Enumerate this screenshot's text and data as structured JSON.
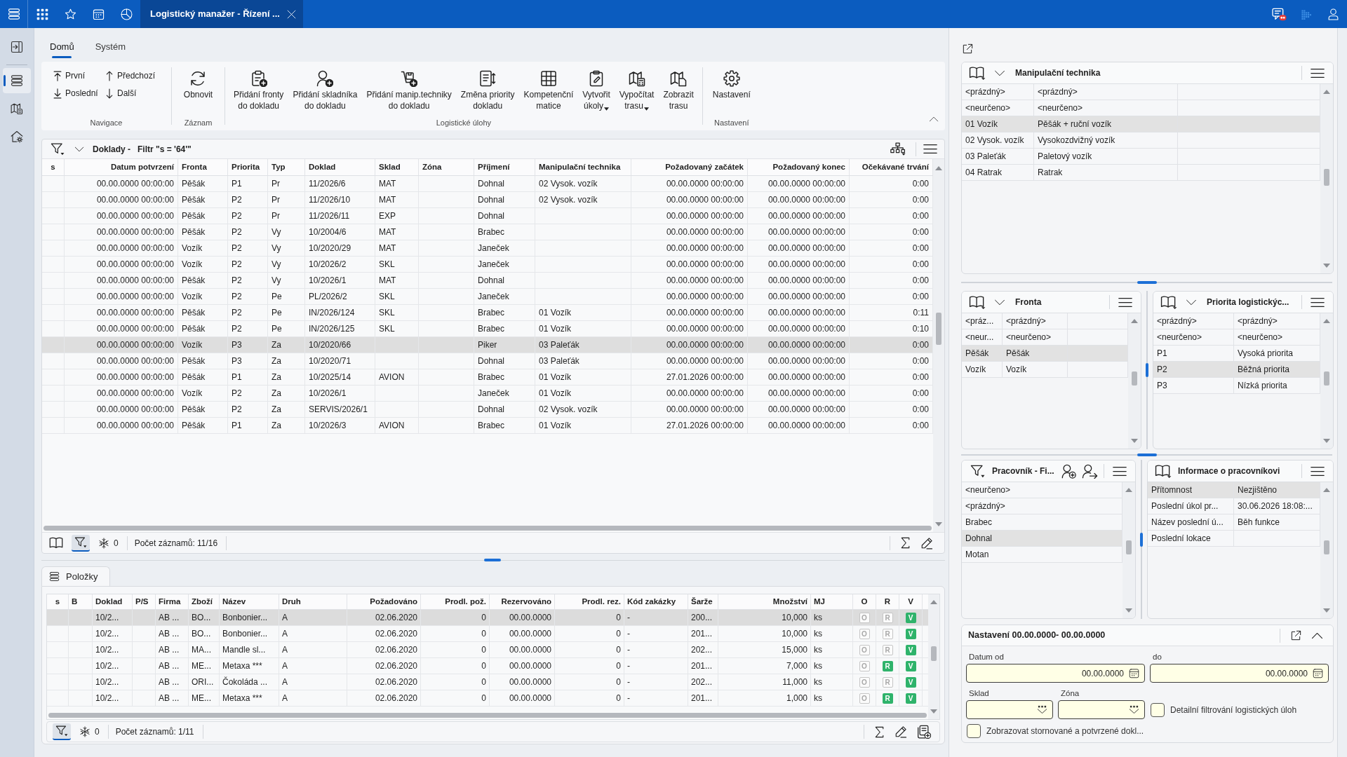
{
  "top_bar": {
    "tabs": [
      {
        "title": "Logistický manažer - Řízení ...",
        "selected": true
      }
    ]
  },
  "sidebar": {
    "items": [
      {
        "selected": false
      },
      {
        "selected": true
      },
      {
        "selected": false
      },
      {
        "selected": false
      }
    ]
  },
  "ribbon": {
    "tabs": [
      {
        "label": "Domů",
        "selected": true
      },
      {
        "label": "Systém",
        "selected": false
      }
    ],
    "groups": [
      {
        "kind": "navigation",
        "label": "Navigace",
        "buttons": [
          {
            "label": "První"
          },
          {
            "label": "Předchozí"
          },
          {
            "label": "Poslední"
          },
          {
            "label": "Další"
          }
        ]
      },
      {
        "kind": "large",
        "label": "Záznam",
        "buttons": [
          {
            "label": "Obnovit",
            "dropdown": false
          }
        ]
      },
      {
        "kind": "large",
        "label": "Logistické úlohy",
        "buttons": [
          {
            "label": "Přidání fronty\ndo dokladu",
            "dropdown": false
          },
          {
            "label": "Přidání skladníka\ndo dokladu",
            "dropdown": false
          },
          {
            "label": "Přidání manip.techniky\ndo dokladu",
            "dropdown": false
          },
          {
            "label": "Změna priority\ndokladu",
            "dropdown": false
          },
          {
            "label": "Kompetenční\nmatice",
            "dropdown": false
          },
          {
            "label": "Vytvořit\núkoly",
            "dropdown": true
          },
          {
            "label": "Vypočítat\ntrasu",
            "dropdown": true
          },
          {
            "label": "Zobrazit\ntrasu",
            "dropdown": false
          }
        ]
      },
      {
        "kind": "large",
        "label": "Nastavení",
        "buttons": [
          {
            "label": "Nastavení",
            "dropdown": false
          }
        ]
      }
    ]
  },
  "documents": {
    "title": "Doklady -",
    "filter": "Filtr \"s = '64'\"",
    "columns": [
      "s",
      "Datum potvrzení",
      "Fronta",
      "Priorita",
      "Typ",
      "Doklad",
      "Sklad",
      "Zóna",
      "Příjmení",
      "Manipulační technika",
      "Požadovaný začátek",
      "Požadovaný konec",
      "Očekávané trvání"
    ],
    "rows": [
      {
        "selected": false,
        "cells": [
          null,
          "00.00.0000 00:00:00",
          "Pěšák",
          "P1",
          "Pr",
          "11/2026/6",
          "MAT",
          null,
          "Dohnal",
          "02 Vysok. vozík",
          "00.00.0000 00:00:00",
          "00.00.0000 00:00:00",
          "0:00"
        ]
      },
      {
        "selected": false,
        "cells": [
          null,
          "00.00.0000 00:00:00",
          "Pěšák",
          "P2",
          "Pr",
          "11/2026/10",
          "MAT",
          null,
          "Dohnal",
          "02 Vysok. vozík",
          "00.00.0000 00:00:00",
          "00.00.0000 00:00:00",
          "0:00"
        ]
      },
      {
        "selected": false,
        "cells": [
          null,
          "00.00.0000 00:00:00",
          "Pěšák",
          "P2",
          "Pr",
          "11/2026/11",
          "EXP",
          null,
          "Dohnal",
          null,
          "00.00.0000 00:00:00",
          "00.00.0000 00:00:00",
          "0:00"
        ]
      },
      {
        "selected": false,
        "cells": [
          null,
          "00.00.0000 00:00:00",
          "Pěšák",
          "P2",
          "Vy",
          "10/2004/6",
          "MAT",
          null,
          "Brabec",
          null,
          "00.00.0000 00:00:00",
          "00.00.0000 00:00:00",
          "0:00"
        ]
      },
      {
        "selected": false,
        "cells": [
          null,
          "00.00.0000 00:00:00",
          "Vozík",
          "P2",
          "Vy",
          "10/2020/29",
          "MAT",
          null,
          "Janeček",
          null,
          "00.00.0000 00:00:00",
          "00.00.0000 00:00:00",
          "0:00"
        ]
      },
      {
        "selected": false,
        "cells": [
          null,
          "00.00.0000 00:00:00",
          "Vozík",
          "P2",
          "Vy",
          "10/2026/2",
          "SKL",
          null,
          "Janeček",
          null,
          "00.00.0000 00:00:00",
          "00.00.0000 00:00:00",
          "0:00"
        ]
      },
      {
        "selected": false,
        "cells": [
          null,
          "00.00.0000 00:00:00",
          "Pěšák",
          "P2",
          "Vy",
          "10/2026/1",
          "MAT",
          null,
          "Dohnal",
          null,
          "00.00.0000 00:00:00",
          "00.00.0000 00:00:00",
          "0:00"
        ]
      },
      {
        "selected": false,
        "cells": [
          null,
          "00.00.0000 00:00:00",
          "Vozík",
          "P2",
          "Pe",
          "PL/2026/2",
          "SKL",
          null,
          "Janeček",
          null,
          "00.00.0000 00:00:00",
          "00.00.0000 00:00:00",
          "0:00"
        ]
      },
      {
        "selected": false,
        "cells": [
          null,
          "00.00.0000 00:00:00",
          "Pěšák",
          "P2",
          "Pe",
          "IN/2026/124",
          "SKL",
          null,
          "Brabec",
          "01 Vozík",
          "00.00.0000 00:00:00",
          "00.00.0000 00:00:00",
          "0:11"
        ]
      },
      {
        "selected": false,
        "cells": [
          null,
          "00.00.0000 00:00:00",
          "Pěšák",
          "P2",
          "Pe",
          "IN/2026/125",
          "SKL",
          null,
          "Brabec",
          "01 Vozík",
          "00.00.0000 00:00:00",
          "00.00.0000 00:00:00",
          "0:10"
        ]
      },
      {
        "selected": true,
        "cells": [
          null,
          "00.00.0000 00:00:00",
          "Vozík",
          "P3",
          "Za",
          "10/2020/66",
          null,
          null,
          "Piker",
          "03 Paleťák",
          "00.00.0000 00:00:00",
          "00.00.0000 00:00:00",
          "0:00"
        ]
      },
      {
        "selected": false,
        "cells": [
          null,
          "00.00.0000 00:00:00",
          "Pěšák",
          "P3",
          "Za",
          "10/2020/71",
          null,
          null,
          "Dohnal",
          "03 Paleťák",
          "00.00.0000 00:00:00",
          "00.00.0000 00:00:00",
          "0:00"
        ]
      },
      {
        "selected": false,
        "cells": [
          null,
          "00.00.0000 00:00:00",
          "Pěšák",
          "P1",
          "Za",
          "10/2025/14",
          "AVION",
          null,
          "Brabec",
          "01 Vozík",
          "27.01.2026 00:00:00",
          "00.00.0000 00:00:00",
          "0:00"
        ]
      },
      {
        "selected": false,
        "cells": [
          null,
          "00.00.0000 00:00:00",
          "Vozík",
          "P2",
          "Za",
          "10/2026/1",
          null,
          null,
          "Janeček",
          "01 Vozík",
          "00.00.0000 00:00:00",
          "00.00.0000 00:00:00",
          "0:00"
        ]
      },
      {
        "selected": false,
        "cells": [
          null,
          "00.00.0000 00:00:00",
          "Pěšák",
          "P2",
          "Za",
          "SERVIS/2026/1",
          null,
          null,
          "Dohnal",
          "02 Vysok. vozík",
          "00.00.0000 00:00:00",
          "00.00.0000 00:00:00",
          "0:00"
        ]
      },
      {
        "selected": false,
        "cells": [
          null,
          "00.00.0000 00:00:00",
          "Pěšák",
          "P1",
          "Za",
          "10/2026/3",
          "AVION",
          null,
          "Brabec",
          "01 Vozík",
          "27.01.2026 00:00:00",
          "00.00.0000 00:00:00",
          "0:00"
        ]
      }
    ],
    "footer": {
      "filter_active": true,
      "frozen_count": "0",
      "record_count": "Počet záznamů: 11/16"
    }
  },
  "items_panel": {
    "tab": "Položky",
    "columns": [
      "s",
      "B",
      "Doklad",
      "P/S",
      "Firma",
      "Zboží",
      "Název",
      "Druh",
      "Požadováno",
      "Prodl. pož.",
      "Rezervováno",
      "Prodl. rez.",
      "Kód zakázky",
      "Šarže",
      "Množství",
      "MJ",
      "O",
      "R",
      "V"
    ],
    "rows": [
      {
        "selected": true,
        "cells": [
          null,
          null,
          "10/2...",
          null,
          "AB ...",
          "BO...",
          "Bonbonier...",
          "A",
          "02.06.2020",
          "0",
          "00.00.0000",
          "0",
          "-",
          "200...",
          "10,000",
          "ks"
        ],
        "flags": [
          {
            "label": "O",
            "on": false
          },
          {
            "label": "R",
            "on": false
          },
          {
            "label": "V",
            "on": true
          }
        ]
      },
      {
        "selected": false,
        "cells": [
          null,
          null,
          "10/2...",
          null,
          "AB ...",
          "BO...",
          "Bonbonier...",
          "A",
          "02.06.2020",
          "0",
          "00.00.0000",
          "0",
          "-",
          "201...",
          "10,000",
          "ks"
        ],
        "flags": [
          {
            "label": "O",
            "on": false
          },
          {
            "label": "R",
            "on": false
          },
          {
            "label": "V",
            "on": true
          }
        ]
      },
      {
        "selected": false,
        "cells": [
          null,
          null,
          "10/2...",
          null,
          "AB ...",
          "MA...",
          "Mandle sl...",
          "A",
          "02.06.2020",
          "0",
          "00.00.0000",
          "0",
          "-",
          "202...",
          "15,000",
          "ks"
        ],
        "flags": [
          {
            "label": "O",
            "on": false
          },
          {
            "label": "R",
            "on": false
          },
          {
            "label": "V",
            "on": true
          }
        ]
      },
      {
        "selected": false,
        "cells": [
          null,
          null,
          "10/2...",
          null,
          "AB ...",
          "ME...",
          "Metaxa ***",
          "A",
          "02.06.2020",
          "0",
          "00.00.0000",
          "0",
          "-",
          "201...",
          "7,000",
          "ks"
        ],
        "flags": [
          {
            "label": "O",
            "on": false
          },
          {
            "label": "R",
            "on": true
          },
          {
            "label": "V",
            "on": true
          }
        ]
      },
      {
        "selected": false,
        "cells": [
          null,
          null,
          "10/2...",
          null,
          "AB ...",
          "ORI...",
          "Čokoláda ...",
          "A",
          "02.06.2020",
          "0",
          "00.00.0000",
          "0",
          "-",
          "202...",
          "11,000",
          "ks"
        ],
        "flags": [
          {
            "label": "O",
            "on": false
          },
          {
            "label": "R",
            "on": false
          },
          {
            "label": "V",
            "on": true
          }
        ]
      },
      {
        "selected": false,
        "cells": [
          null,
          null,
          "10/2...",
          null,
          "AB ...",
          "ME...",
          "Metaxa ***",
          "A",
          "02.06.2020",
          "0",
          "00.00.0000",
          "0",
          "-",
          "201...",
          "1,000",
          "ks"
        ],
        "flags": [
          {
            "label": "O",
            "on": false
          },
          {
            "label": "R",
            "on": true
          },
          {
            "label": "V",
            "on": true
          }
        ]
      }
    ],
    "footer": {
      "filter_active": true,
      "frozen_count": "0",
      "record_count": "Počet záznamů: 1/11"
    }
  },
  "handling_equipment": {
    "title": "Manipulační technika",
    "rows": [
      {
        "selected": false,
        "cells": [
          "<prázdný>",
          "<prázdný>"
        ]
      },
      {
        "selected": false,
        "cells": [
          "<neurčeno>",
          "<neurčeno>"
        ]
      },
      {
        "selected": true,
        "cells": [
          "01 Vozík",
          "Pěšák + ruční vozík"
        ]
      },
      {
        "selected": false,
        "cells": [
          "02 Vysok. vozík",
          "Vysokozdvižný vozík"
        ]
      },
      {
        "selected": false,
        "cells": [
          "03 Paleťák",
          "Paletový vozík"
        ]
      },
      {
        "selected": false,
        "cells": [
          "04 Ratrak",
          "Ratrak"
        ]
      }
    ]
  },
  "queue": {
    "title": "Fronta",
    "rows": [
      {
        "selected": false,
        "cells": [
          "<práz...",
          "<prázdný>"
        ]
      },
      {
        "selected": false,
        "cells": [
          "<neur...",
          "<neurčeno>"
        ]
      },
      {
        "selected": true,
        "cells": [
          "Pěšák",
          "Pěšák"
        ]
      },
      {
        "selected": false,
        "cells": [
          "Vozík",
          "Vozík"
        ]
      }
    ]
  },
  "priority": {
    "title": "Priorita logistickýc...",
    "rows": [
      {
        "selected": false,
        "cells": [
          "<prázdný>",
          "<prázdný>"
        ]
      },
      {
        "selected": false,
        "cells": [
          "<neurčeno>",
          "<neurčeno>"
        ]
      },
      {
        "selected": false,
        "cells": [
          "P1",
          "Vysoká priorita"
        ]
      },
      {
        "selected": true,
        "cells": [
          "P2",
          "Běžná priorita"
        ]
      },
      {
        "selected": false,
        "cells": [
          "P3",
          "Nízká priorita"
        ]
      }
    ]
  },
  "workers": {
    "title": "Pracovník - Fi...",
    "rows": [
      {
        "selected": false,
        "cells": [
          "<neurčeno>"
        ]
      },
      {
        "selected": false,
        "cells": [
          "<prázdný>"
        ]
      },
      {
        "selected": false,
        "cells": [
          "Brabec"
        ]
      },
      {
        "selected": true,
        "cells": [
          "Dohnal"
        ]
      },
      {
        "selected": false,
        "cells": [
          "Motan"
        ]
      }
    ]
  },
  "worker_info": {
    "title": "Informace o pracovníkovi",
    "rows": [
      {
        "selected": true,
        "cells": [
          "Přítomnost",
          "Nezjištěno"
        ]
      },
      {
        "selected": false,
        "cells": [
          "Poslední úkol pr...",
          "30.06.2026 18:08:..."
        ]
      },
      {
        "selected": false,
        "cells": [
          "Název poslední ú...",
          "Běh funkce"
        ]
      },
      {
        "selected": false,
        "cells": [
          "Poslední lokace",
          null
        ]
      }
    ]
  },
  "settings": {
    "title": "Nastavení 00.00.0000- 00.00.0000",
    "expanded": true,
    "date_from": {
      "label": "Datum od",
      "value": "00.00.0000"
    },
    "date_to": {
      "label": "do",
      "value": "00.00.0000"
    },
    "warehouse": {
      "label": "Sklad"
    },
    "zone": {
      "label": "Zóna"
    },
    "checkboxes": [
      {
        "label": "Detailní filtrování logistických úloh",
        "checked": false
      },
      {
        "label": "Zobrazovat stornované a potvrzené dokl...",
        "checked": false
      }
    ]
  }
}
